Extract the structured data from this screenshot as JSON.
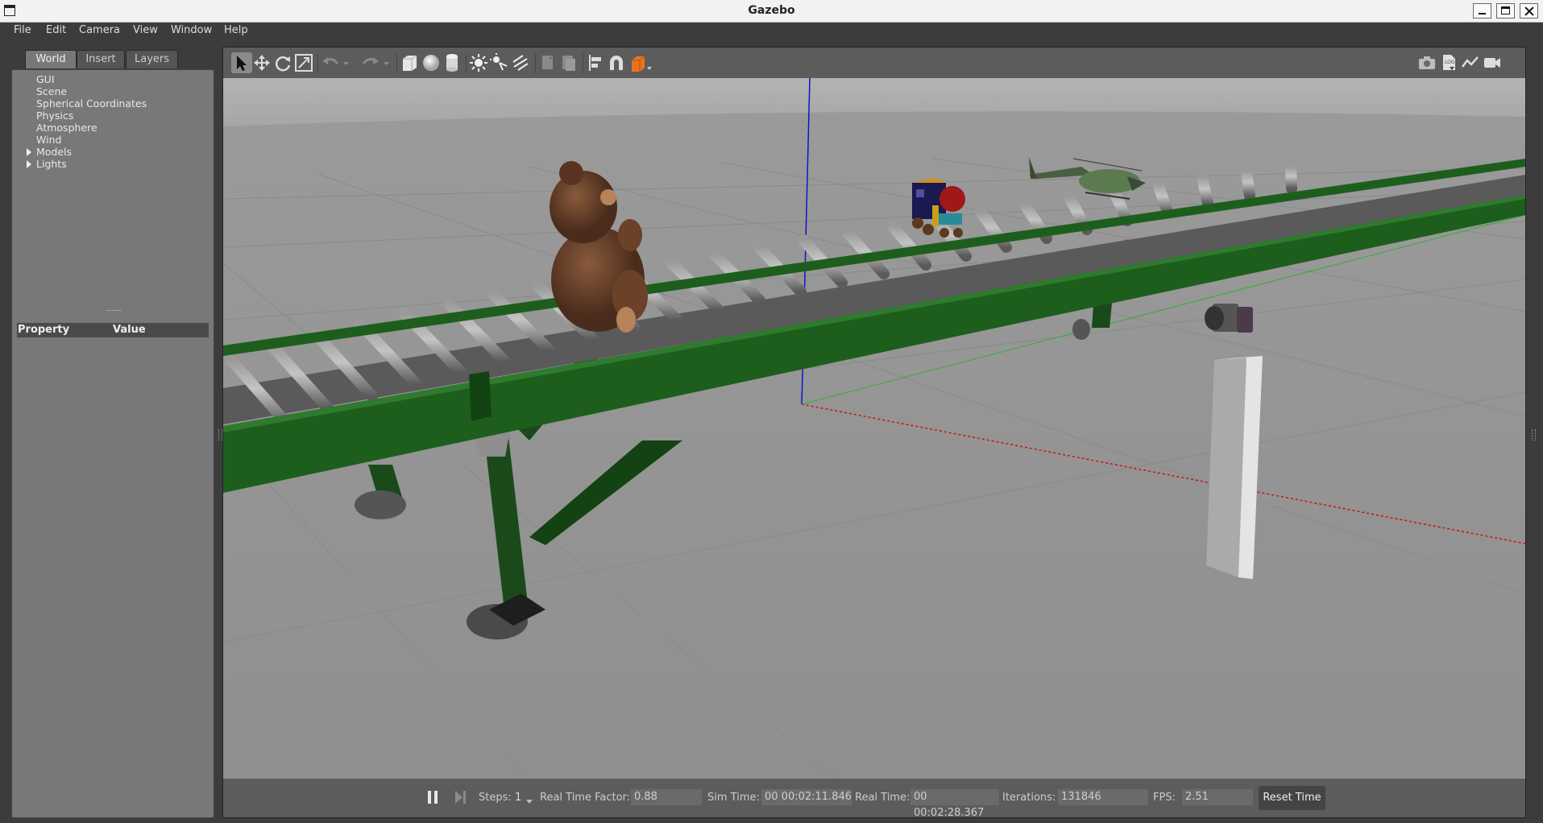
{
  "window": {
    "title": "Gazebo"
  },
  "menu": [
    "File",
    "Edit",
    "Camera",
    "View",
    "Window",
    "Help"
  ],
  "left_panel": {
    "tabs": [
      "World",
      "Insert",
      "Layers"
    ],
    "active_tab": "World",
    "tree": [
      {
        "label": "GUI",
        "expandable": false
      },
      {
        "label": "Scene",
        "expandable": false
      },
      {
        "label": "Spherical Coordinates",
        "expandable": false
      },
      {
        "label": "Physics",
        "expandable": false
      },
      {
        "label": "Atmosphere",
        "expandable": false
      },
      {
        "label": "Wind",
        "expandable": false
      },
      {
        "label": "Models",
        "expandable": true
      },
      {
        "label": "Lights",
        "expandable": true
      }
    ],
    "property_header": {
      "property": "Property",
      "value": "Value"
    }
  },
  "toolbar": {
    "icons": [
      "select-arrow-icon",
      "translate-icon",
      "rotate-icon",
      "scale-icon",
      "undo-icon",
      "undo-dropdown-icon",
      "redo-icon",
      "redo-dropdown-icon",
      "box-shape-icon",
      "sphere-shape-icon",
      "cylinder-shape-icon",
      "point-light-icon",
      "spot-light-icon",
      "directional-light-icon",
      "copy-icon",
      "paste-icon",
      "align-icon",
      "snap-magnet-icon",
      "view-angle-icon",
      "screenshot-camera-icon",
      "log-icon",
      "plot-icon",
      "video-record-icon"
    ]
  },
  "colors": {
    "conveyor_green": "#1d5e1d",
    "axis_z": "#1010d0",
    "axis_x": "#d01010",
    "axis_y": "#20c020",
    "ground": "#9c9c9c",
    "sky": "#b4b4b4"
  },
  "bottom": {
    "steps_label": "Steps:",
    "steps_value": "1",
    "rtf_label": "Real Time Factor:",
    "rtf_value": "0.88",
    "sim_time_label": "Sim Time:",
    "sim_time_value": "00 00:02:11.846",
    "real_time_label": "Real Time:",
    "real_time_value": "00 00:02:28.367",
    "iterations_label": "Iterations:",
    "iterations_value": "131846",
    "fps_label": "FPS:",
    "fps_value": "2.51",
    "reset_label": "Reset Time"
  }
}
